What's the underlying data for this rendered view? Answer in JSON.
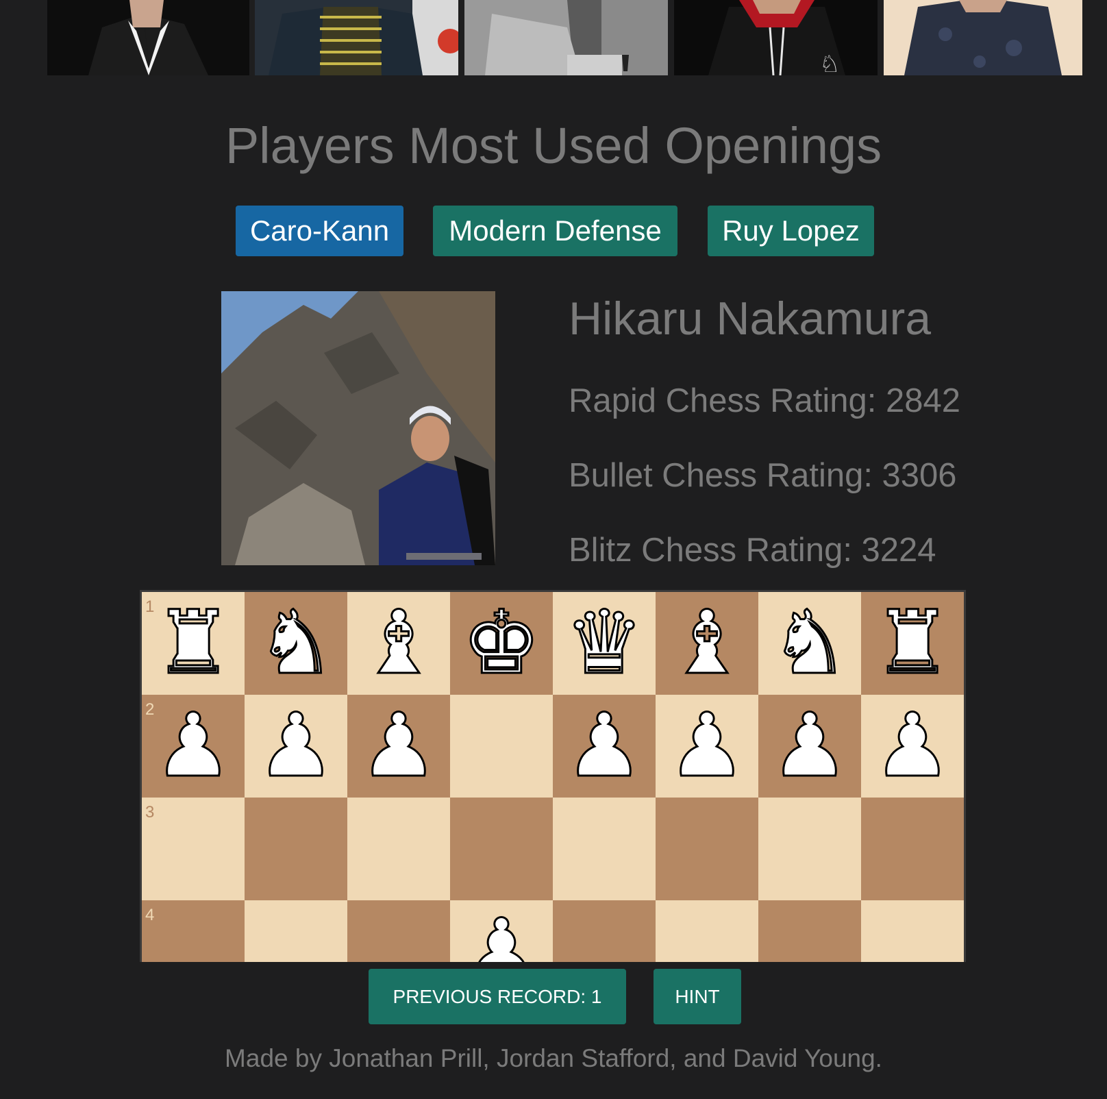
{
  "header": {
    "photos": [
      {
        "name": "player-photo-1"
      },
      {
        "name": "player-photo-2"
      },
      {
        "name": "player-photo-3"
      },
      {
        "name": "player-photo-4"
      },
      {
        "name": "player-photo-5"
      }
    ]
  },
  "title": "Players Most Used Openings",
  "openings": [
    {
      "label": "Caro-Kann",
      "color": "#1767a3",
      "selected": true
    },
    {
      "label": "Modern Defense",
      "color": "#1a7264",
      "selected": false
    },
    {
      "label": "Ruy Lopez",
      "color": "#1a7264",
      "selected": false
    }
  ],
  "player": {
    "name": "Hikaru Nakamura",
    "ratings": [
      "Rapid Chess Rating: 2842",
      "Bullet Chess Rating: 3306",
      "Blitz Chess Rating: 3224"
    ]
  },
  "board": {
    "rank_labels": [
      "1",
      "2",
      "3",
      "4"
    ],
    "rows": [
      [
        "rook",
        "knight",
        "bishop",
        "king",
        "queen",
        "bishop",
        "knight",
        "rook"
      ],
      [
        "pawn",
        "pawn",
        "pawn",
        "",
        "pawn",
        "pawn",
        "pawn",
        "pawn"
      ],
      [
        "",
        "",
        "",
        "",
        "",
        "",
        "",
        ""
      ],
      [
        "",
        "",
        "",
        "pawn",
        "",
        "",
        "",
        ""
      ]
    ],
    "colors": {
      "light": "#f0d9b5",
      "dark": "#b58863"
    }
  },
  "buttons": {
    "previous_record": "PREVIOUS RECORD: 1",
    "hint": "HINT"
  },
  "footer": "Made by Jonathan Prill, Jordan Stafford, and David Young."
}
